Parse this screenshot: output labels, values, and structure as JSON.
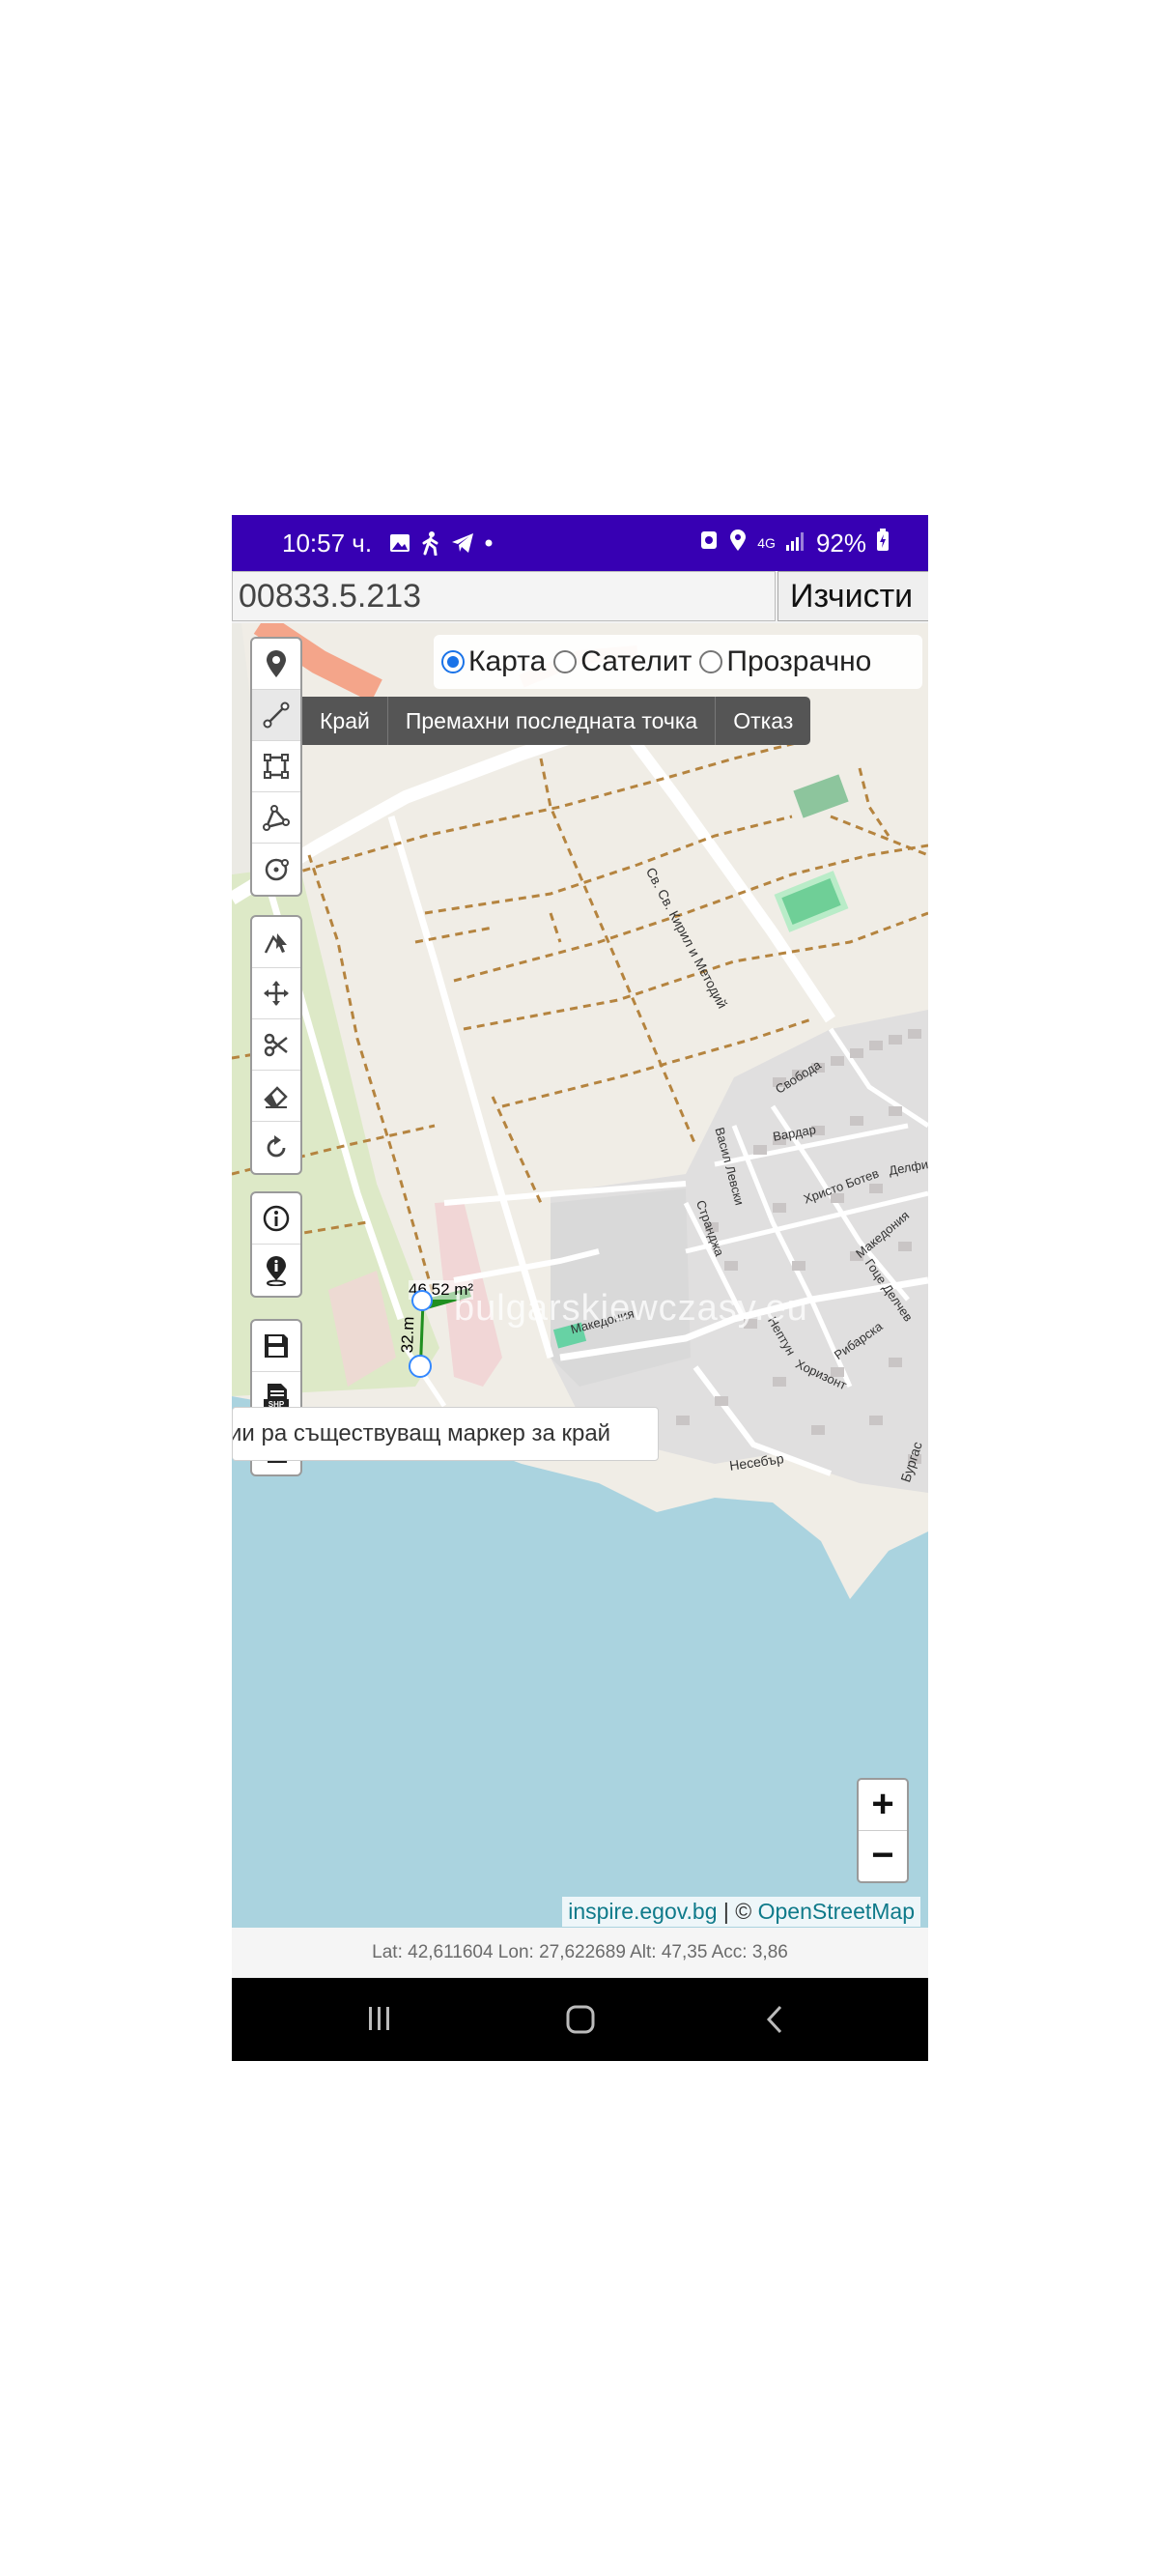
{
  "status_bar": {
    "time": "10:57 ч.",
    "network": "4G",
    "battery": "92%"
  },
  "search": {
    "value": "00833.5.213",
    "clear_label": "Изчисти"
  },
  "layers": {
    "options": [
      {
        "label": "Карта",
        "selected": true
      },
      {
        "label": "Сателит",
        "selected": false
      },
      {
        "label": "Прозрачно",
        "selected": false
      }
    ]
  },
  "draw_actions": {
    "finish": "Край",
    "delete_last": "Премахни последната точка",
    "cancel": "Отказ"
  },
  "tooltip": {
    "text": "и…а съществуващ маркер за край",
    "visible_text": "ии ра съществуващ маркер за край"
  },
  "toolbar": {
    "draw_tools": [
      "marker-icon",
      "polyline-icon",
      "rectangle-icon",
      "polygon-icon",
      "circle-marker-icon"
    ],
    "edit_tools": [
      "cut-polyline-icon",
      "drag-icon",
      "scissors-icon",
      "eraser-icon",
      "rotate-icon"
    ],
    "info_tools": [
      "info-icon",
      "location-info-icon"
    ],
    "file_tools": [
      "save-icon",
      "shp-export-icon",
      "json-export-icon"
    ]
  },
  "measurement": {
    "area": "46.52 m²",
    "length": "32.m"
  },
  "map": {
    "street_labels": [
      "Св. Св. Кирил и Методий",
      "Свобода",
      "Вардар",
      "Васил Левски",
      "Христо Ботев",
      "Делфин",
      "Странджа",
      "Македония",
      "Гоце Делчев",
      "Нептун",
      "Рибарска",
      "Хоризонт",
      "Несебър",
      "Бургас"
    ],
    "watermark": "bulgarskiewczasy.eu",
    "colors": {
      "sea": "#aad3df",
      "land": "#f0ede6",
      "residential": "#e0dfdf",
      "green": "#dde9c7",
      "water_label": "#5c8ea1"
    }
  },
  "zoom": {
    "in": "+",
    "out": "−"
  },
  "attribution": {
    "source1": "inspire.egov.bg",
    "sep": " | © ",
    "source2": "OpenStreetMap"
  },
  "coordinates": {
    "text": "Lat: 42,611604 Lon: 27,622689 Alt: 47,35 Acc: 3,86"
  }
}
